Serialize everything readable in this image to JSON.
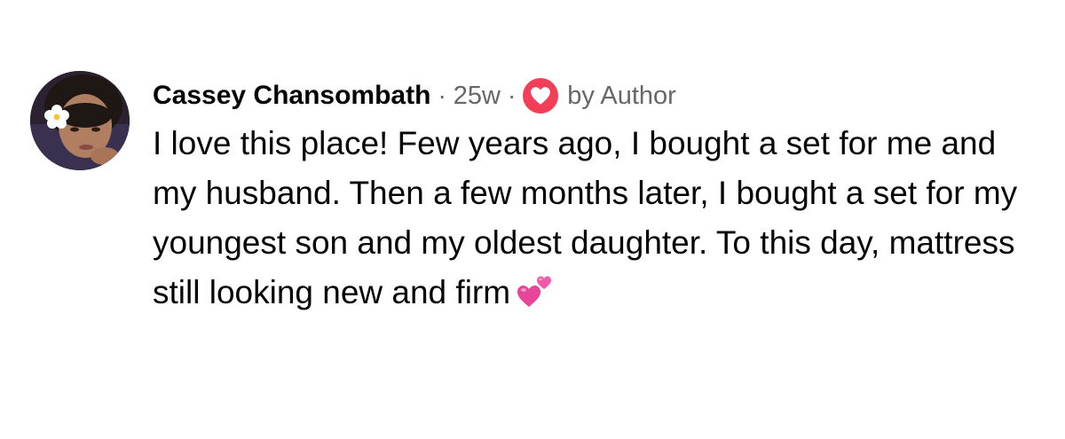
{
  "comment": {
    "author": "Cassey Chansombath",
    "separator": "·",
    "time_ago": "25w",
    "reaction_icon": "heart-icon",
    "reaction_color": "#f33e58",
    "reacted_by": "by Author",
    "text": "I love this place! Few years ago, I bought a set for me and my husband. Then a few months later, I bought a set for my youngest son and my oldest daughter. To this day, mattress still looking new and firm",
    "emoji": "two-hearts-emoji"
  },
  "colors": {
    "text_primary": "#050505",
    "text_secondary": "#65676b",
    "emoji_pink": "#e8449a"
  }
}
